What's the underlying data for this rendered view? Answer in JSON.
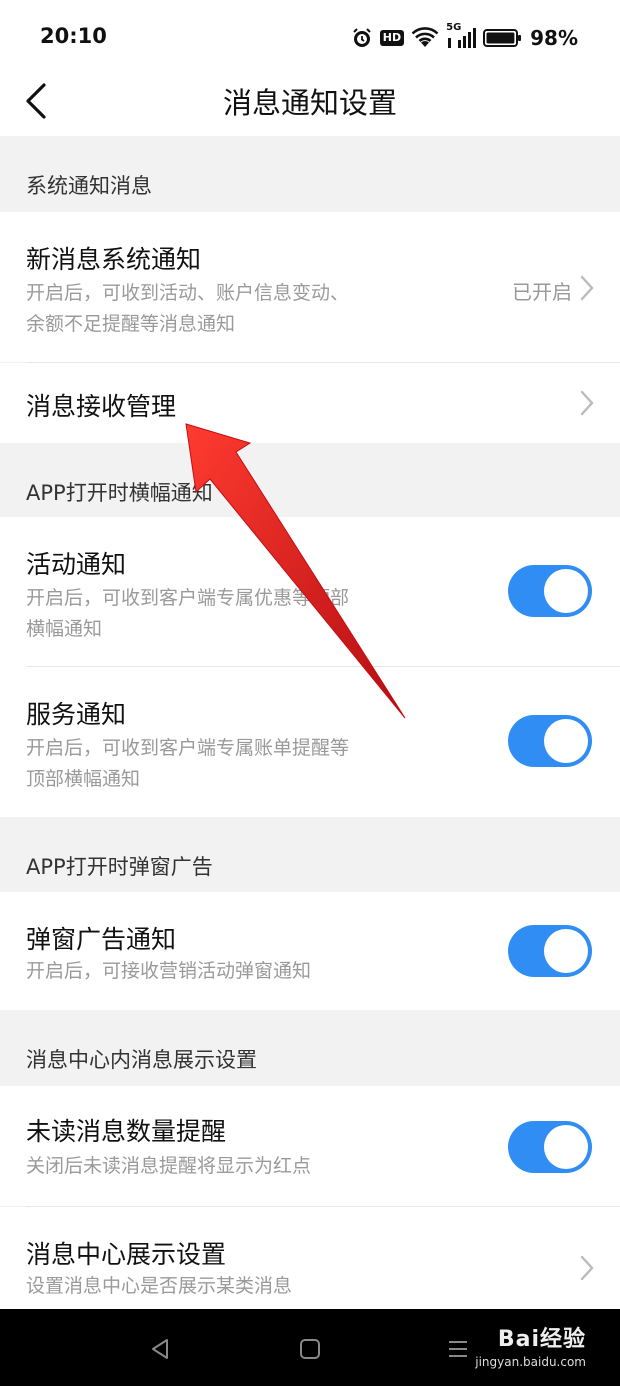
{
  "status_bar": {
    "time": "20:10",
    "icons": [
      "alarm-icon",
      "hd-icon",
      "wifi-icon",
      "5g-signal-icon",
      "battery-icon"
    ],
    "hd_label": "HD",
    "network_label": "5G",
    "battery_percent": "98%",
    "battery_level": 0.98
  },
  "header": {
    "title": "消息通知设置"
  },
  "sections": {
    "system": {
      "header": "系统通知消息",
      "new_message": {
        "title": "新消息系统通知",
        "desc_line1": "开启后，可收到活动、账户信息变动、",
        "desc_line2": "余额不足提醒等消息通知",
        "value": "已开启"
      },
      "receive_manage": {
        "title": "消息接收管理"
      }
    },
    "banner": {
      "header": "APP打开时横幅通知",
      "activity": {
        "title": "活动通知",
        "desc_line1": "开启后，可收到客户端专属优惠等顶部",
        "desc_line2": "横幅通知",
        "enabled": true
      },
      "service": {
        "title": "服务通知",
        "desc_line1": "开启后，可收到客户端专属账单提醒等",
        "desc_line2": "顶部横幅通知",
        "enabled": true
      }
    },
    "popup": {
      "header": "APP打开时弹窗广告",
      "popup_ad": {
        "title": "弹窗广告通知",
        "desc": "开启后，可接收营销活动弹窗通知",
        "enabled": true
      }
    },
    "center": {
      "header": "消息中心内消息展示设置",
      "unread": {
        "title": "未读消息数量提醒",
        "desc": "关闭后未读消息提醒将显示为红点",
        "enabled": true
      },
      "display": {
        "title": "消息中心展示设置",
        "desc": "设置消息中心是否展示某类消息"
      }
    }
  },
  "watermark": {
    "brand": "Bai经验",
    "url": "jingyan.baidu.com"
  },
  "colors": {
    "toggle_on": "#2f8df3",
    "annotation_arrow": "#e0161b"
  }
}
